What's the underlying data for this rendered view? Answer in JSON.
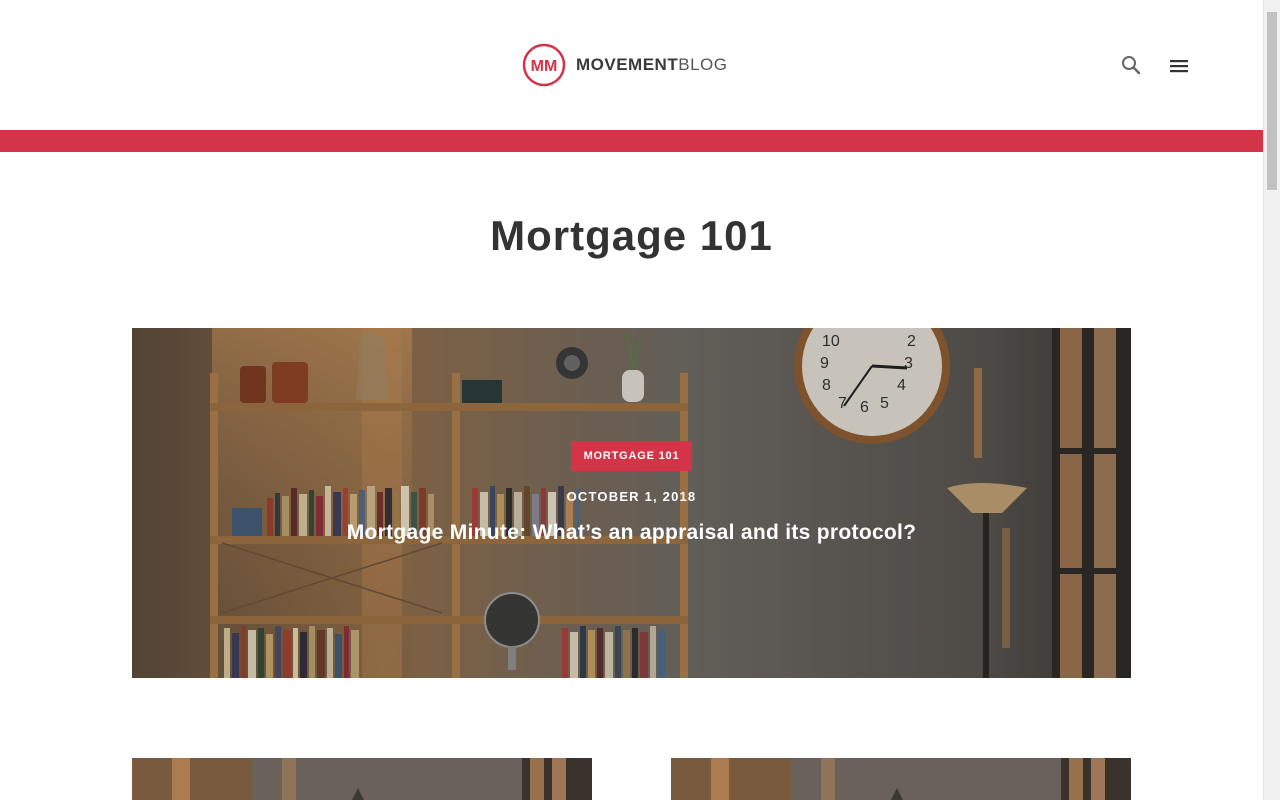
{
  "header": {
    "logo_mark": "MM",
    "logo_bold": "MOVEMENT",
    "logo_light": "BLOG",
    "search_icon": "search-icon",
    "menu_icon": "hamburger-menu-icon"
  },
  "colors": {
    "brand_red": "#d33447",
    "text_dark": "#333333"
  },
  "page": {
    "title": "Mortgage 101"
  },
  "featured_post": {
    "category": "MORTGAGE 101",
    "date": "OCTOBER 1, 2018",
    "title": "Mortgage Minute: What’s an appraisal and its protocol?"
  },
  "cards": [
    {
      "image": "post-thumbnail"
    },
    {
      "image": "post-thumbnail"
    }
  ]
}
